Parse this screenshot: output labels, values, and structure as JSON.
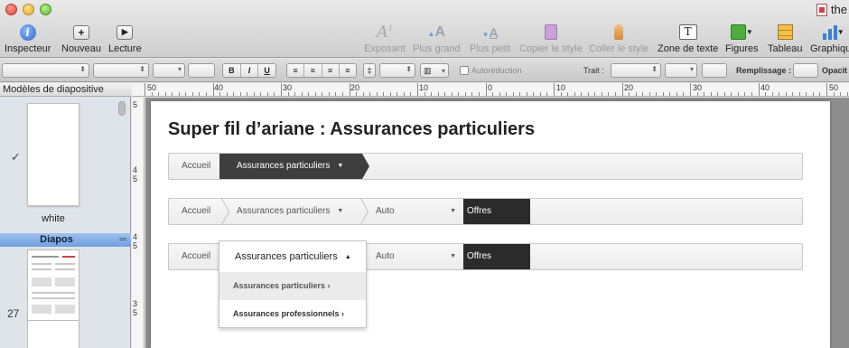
{
  "window": {
    "doc_title": "the"
  },
  "toolbar": {
    "inspector": "Inspecteur",
    "new": "Nouveau",
    "play": "Lecture",
    "exposure": "Exposant",
    "bigger": "Plus grand",
    "smaller": "Plus petit",
    "copy_style": "Copier le style",
    "paste_style": "Coller le style",
    "text_box": "Zone de texte",
    "shapes": "Figures",
    "table": "Tableau",
    "chart": "Graphique"
  },
  "format_bar": {
    "bold": "B",
    "italic": "I",
    "underline": "U",
    "autoreduce": "Autoréduction",
    "stroke": "Trait :",
    "fill": "Remplissage :",
    "opacity": "Opacit"
  },
  "sidebar": {
    "header": "Modèles de diapositive",
    "master_label": "white",
    "section": "Diapos",
    "slide_number": "27"
  },
  "ruler": {
    "h": [
      "50",
      "40",
      "30",
      "20",
      "10",
      "0",
      "10",
      "20",
      "30",
      "40",
      "50"
    ],
    "v": [
      "5",
      "4",
      "5",
      "4",
      "5",
      "3",
      "5"
    ]
  },
  "slide": {
    "title": "Super fil d’ariane : Assurances particuliers",
    "crumb1": {
      "home": "Accueil",
      "current": "Assurances particuliers"
    },
    "crumb2": {
      "home": "Accueil",
      "section": "Assurances particuliers",
      "auto": "Auto",
      "current": "Offres"
    },
    "crumb3": {
      "home": "Accueil",
      "auto": "Auto",
      "current": "Offres"
    },
    "dropdown": {
      "head": "Assurances particuliers",
      "items": [
        "Assurances particuliers ›",
        "Assurances professionnels ›"
      ]
    }
  }
}
